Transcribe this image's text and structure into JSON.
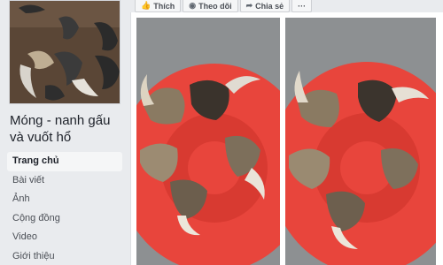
{
  "page": {
    "name": "Móng - nanh gấu và vuốt hổ"
  },
  "sidebar": {
    "items": [
      {
        "label": "Trang chủ",
        "active": true
      },
      {
        "label": "Bài viết",
        "active": false
      },
      {
        "label": "Ảnh",
        "active": false
      },
      {
        "label": "Cộng đồng",
        "active": false
      },
      {
        "label": "Video",
        "active": false
      },
      {
        "label": "Giới thiệu",
        "active": false
      }
    ]
  },
  "actions": {
    "like": "Thích",
    "follow": "Theo dõi",
    "share": "Chia sẻ",
    "more": "···"
  },
  "icons": {
    "like": "thumbs-up-icon",
    "follow": "rss-icon",
    "share": "share-arrow-icon"
  },
  "colors": {
    "background": "#e9ebee",
    "card": "#ffffff",
    "plate": "#e8453c",
    "text": "#1d2129"
  }
}
